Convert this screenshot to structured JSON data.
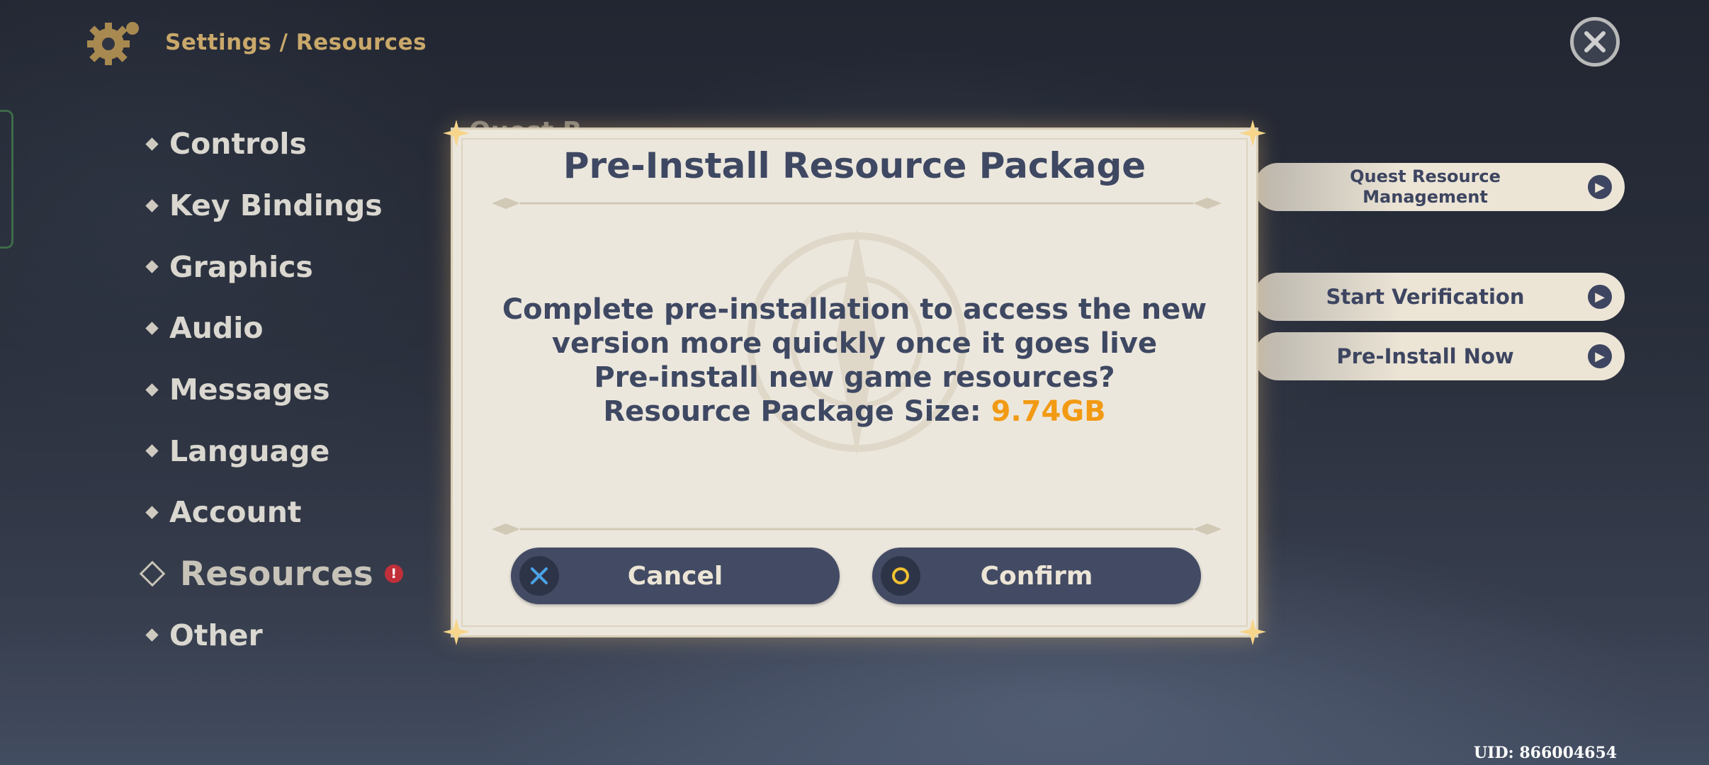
{
  "header": {
    "title": "Settings / Resources"
  },
  "nav": {
    "items": [
      {
        "label": "Controls"
      },
      {
        "label": "Key Bindings"
      },
      {
        "label": "Graphics"
      },
      {
        "label": "Audio"
      },
      {
        "label": "Messages"
      },
      {
        "label": "Language"
      },
      {
        "label": "Account"
      },
      {
        "label": "Resources",
        "active": true,
        "alert": "!"
      },
      {
        "label": "Other"
      }
    ]
  },
  "panel": {
    "sub_heading": "Quest R",
    "quest_resource_line1": "Quest Resource",
    "quest_resource_line2": "Management",
    "start_verification": "Start Verification",
    "pre_install_now": "Pre-Install Now"
  },
  "dialog": {
    "title": "Pre-Install Resource Package",
    "line1": "Complete pre-installation to access the new",
    "line2": "version more quickly once it goes live",
    "line3": "Pre-install new game resources?",
    "size_label": "Resource Package Size: ",
    "size_value": "9.74GB",
    "cancel_label": "Cancel",
    "confirm_label": "Confirm"
  },
  "footer": {
    "uid": "UID: 866004654"
  },
  "colors": {
    "accent_orange": "#f29a13",
    "button_bg": "#434b64",
    "dialog_bg": "#ece7dd",
    "header_gold": "#c9a86a"
  },
  "icons": [
    "gear-icon",
    "close-icon",
    "cross-button-icon",
    "circle-button-icon",
    "arrow-right-icon",
    "alert-icon"
  ]
}
